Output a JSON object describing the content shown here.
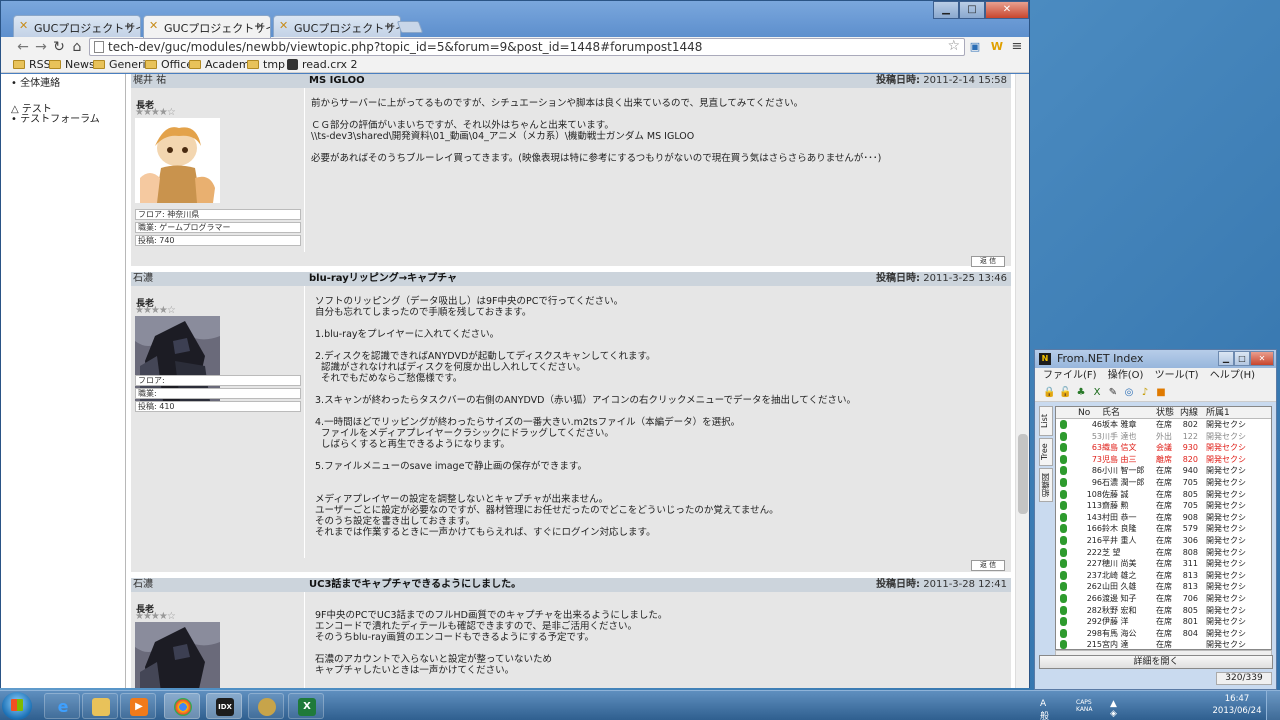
{
  "browser": {
    "tabs": [
      {
        "label": "GUCプロジェクトサイト"
      },
      {
        "label": "GUCプロジェクトサイト"
      },
      {
        "label": "GUCプロジェクトサイト"
      }
    ],
    "url": "tech-dev/guc/modules/newbb/viewtopic.php?topic_id=5&forum=9&post_id=1448#forumpost1448",
    "bookmarks": [
      "RSS",
      "News",
      "Generic",
      "Office",
      "Academic",
      "tmp",
      "read.crx 2"
    ]
  },
  "sidebar": {
    "items": [
      "全体連絡",
      "テスト",
      "テストフォーラム"
    ]
  },
  "posts": [
    {
      "author": "梶井 祐",
      "subject": "MS IGLOO",
      "date_label": "投稿日時:",
      "date": "2011-2-14 15:58",
      "rank": "長老",
      "info": [
        "フロア: 神奈川県",
        "職業: ゲームプログラマー",
        "投稿: 740"
      ],
      "body": [
        "前からサーバーに上がってるものですが、シチュエーションや脚本は良く出来ているので、見直してみてください。",
        "",
        "ＣＧ部分の評価がいまいちですが、それ以外はちゃんと出来ています。",
        "\\\\ts-dev3\\shared\\開発資料\\01_動画\\04_アニメ（メカ系）\\機動戦士ガンダム MS IGLOO",
        "",
        "必要があればそのうちブルーレイ買ってきます。(映像表現は特に参考にするつもりがないので現在買う気はさらさらありませんが･･･)"
      ],
      "reply": "返 信"
    },
    {
      "author": "石濃",
      "subject": "blu-rayリッピング→キャプチャ",
      "date_label": "投稿日時:",
      "date": "2011-3-25 13:46",
      "rank": "長老",
      "info": [
        "フロア:",
        "職業:",
        "投稿: 410"
      ],
      "body": [
        "ソフトのリッピング（データ吸出し）は9F中央のPCで行ってください。",
        "自分も忘れてしまったので手順を残しておきます。",
        "",
        "1.blu-rayをプレイヤーに入れてください。",
        "",
        "2.ディスクを認識できればANYDVDが起動してディスクスキャンしてくれます。",
        "  認識がされなければディスクを何度か出し入れしてください。",
        "  それでもだめならご愁傷様です。",
        "",
        "3.スキャンが終わったらタスクバーの右側のANYDVD（赤い狐）アイコンの右クリックメニューでデータを抽出してください。",
        "",
        "4.一時間ほどでリッピングが終わったらサイズの一番大きい.m2tsファイル（本編データ）を選択。",
        "  ファイルをメディアプレイヤークラシックにドラッグしてください。",
        "  しばらくすると再生できるようになります。",
        "",
        "5.ファイルメニューのsave imageで静止画の保存ができます。",
        "",
        "",
        "メディアプレイヤーの設定を調整しないとキャプチャが出来ません。",
        "ユーザーごとに設定が必要なのですが、器材管理にお任せだったのでどこをどういじったのか覚えてません。",
        "そのうち設定を書き出しておきます。",
        "それまでは作業するときに一声かけてもらえれば、すぐにログイン対応します。"
      ],
      "reply": "返 信"
    },
    {
      "author": "石濃",
      "subject": "UC3話までキャプチャできるようにしました。",
      "date_label": "投稿日時:",
      "date": "2011-3-28 12:41",
      "rank": "長老",
      "info": [],
      "body": [
        "9F中央のPCでUC3話までのフルHD画質でのキャプチャを出来るようにしました。",
        "エンコードで潰れたディテールも確認できますので、是非ご活用ください。",
        "そのうちblu-ray画質のエンコードもできるようにする予定です。",
        "",
        "石濃のアカウントで入らないと設定が整っていないため",
        "キャプチャしたいときは一声かけてください。"
      ],
      "reply": ""
    }
  ],
  "fromnet": {
    "title": "From.NET Index",
    "menu": [
      "ファイル(F)",
      "操作(O)",
      "ツール(T)",
      "ヘルプ(H)"
    ],
    "side_tabs": [
      "List",
      "Tree",
      "組織図"
    ],
    "columns": [
      "No",
      "氏名",
      "状態",
      "内線",
      "所属1"
    ],
    "rows": [
      {
        "no": "46",
        "name": "坂本 雅章",
        "status": "在席",
        "ext": "802",
        "dept": "開発セクシ",
        "color": "#222"
      },
      {
        "no": "53",
        "name": "川手 達也",
        "status": "外出",
        "ext": "122",
        "dept": "開発セクシ",
        "color": "#888"
      },
      {
        "no": "63",
        "name": "織島 信文",
        "status": "会議",
        "ext": "930",
        "dept": "開発セクシ",
        "color": "#e0201a"
      },
      {
        "no": "73",
        "name": "児島 由三",
        "status": "離席",
        "ext": "820",
        "dept": "開発セクシ",
        "color": "#e0201a"
      },
      {
        "no": "86",
        "name": "小川 智一郎",
        "status": "在席",
        "ext": "940",
        "dept": "開発セクシ",
        "color": "#222"
      },
      {
        "no": "96",
        "name": "石濃 潤一郎",
        "status": "在席",
        "ext": "705",
        "dept": "開発セクシ",
        "color": "#222"
      },
      {
        "no": "108",
        "name": "佐藤 誠",
        "status": "在席",
        "ext": "805",
        "dept": "開発セクシ",
        "color": "#222"
      },
      {
        "no": "113",
        "name": "齋藤 勲",
        "status": "在席",
        "ext": "705",
        "dept": "開発セクシ",
        "color": "#222"
      },
      {
        "no": "143",
        "name": "村田 恭一",
        "status": "在席",
        "ext": "908",
        "dept": "開発セクシ",
        "color": "#222"
      },
      {
        "no": "166",
        "name": "鈴木 良隆",
        "status": "在席",
        "ext": "579",
        "dept": "開発セクシ",
        "color": "#222"
      },
      {
        "no": "216",
        "name": "平井 重人",
        "status": "在席",
        "ext": "306",
        "dept": "開発セクシ",
        "color": "#222"
      },
      {
        "no": "222",
        "name": "芝 望",
        "status": "在席",
        "ext": "808",
        "dept": "開発セクシ",
        "color": "#222"
      },
      {
        "no": "227",
        "name": "穂川 尚美",
        "status": "在席",
        "ext": "311",
        "dept": "開発セクシ",
        "color": "#222"
      },
      {
        "no": "237",
        "name": "北崎 雄之",
        "status": "在席",
        "ext": "813",
        "dept": "開発セクシ",
        "color": "#222"
      },
      {
        "no": "262",
        "name": "山田 久雄",
        "status": "在席",
        "ext": "813",
        "dept": "開発セクシ",
        "color": "#222"
      },
      {
        "no": "266",
        "name": "渡邊 知子",
        "status": "在席",
        "ext": "706",
        "dept": "開発セクシ",
        "color": "#222"
      },
      {
        "no": "282",
        "name": "秋野 宏和",
        "status": "在席",
        "ext": "805",
        "dept": "開発セクシ",
        "color": "#222"
      },
      {
        "no": "292",
        "name": "伊藤 洋",
        "status": "在席",
        "ext": "801",
        "dept": "開発セクシ",
        "color": "#222"
      },
      {
        "no": "298",
        "name": "有馬 海公",
        "status": "在席",
        "ext": "804",
        "dept": "開発セクシ",
        "color": "#222"
      },
      {
        "no": "215",
        "name": "宮内 達",
        "status": "在席",
        "ext": "",
        "dept": "開発セクシ",
        "color": "#222"
      }
    ],
    "detail_button": "詳細を開く",
    "count": "320/339"
  },
  "taskbar": {
    "ime": "A 般",
    "caps": "CAPS KANA",
    "time": "16:47",
    "date": "2013/06/24"
  }
}
